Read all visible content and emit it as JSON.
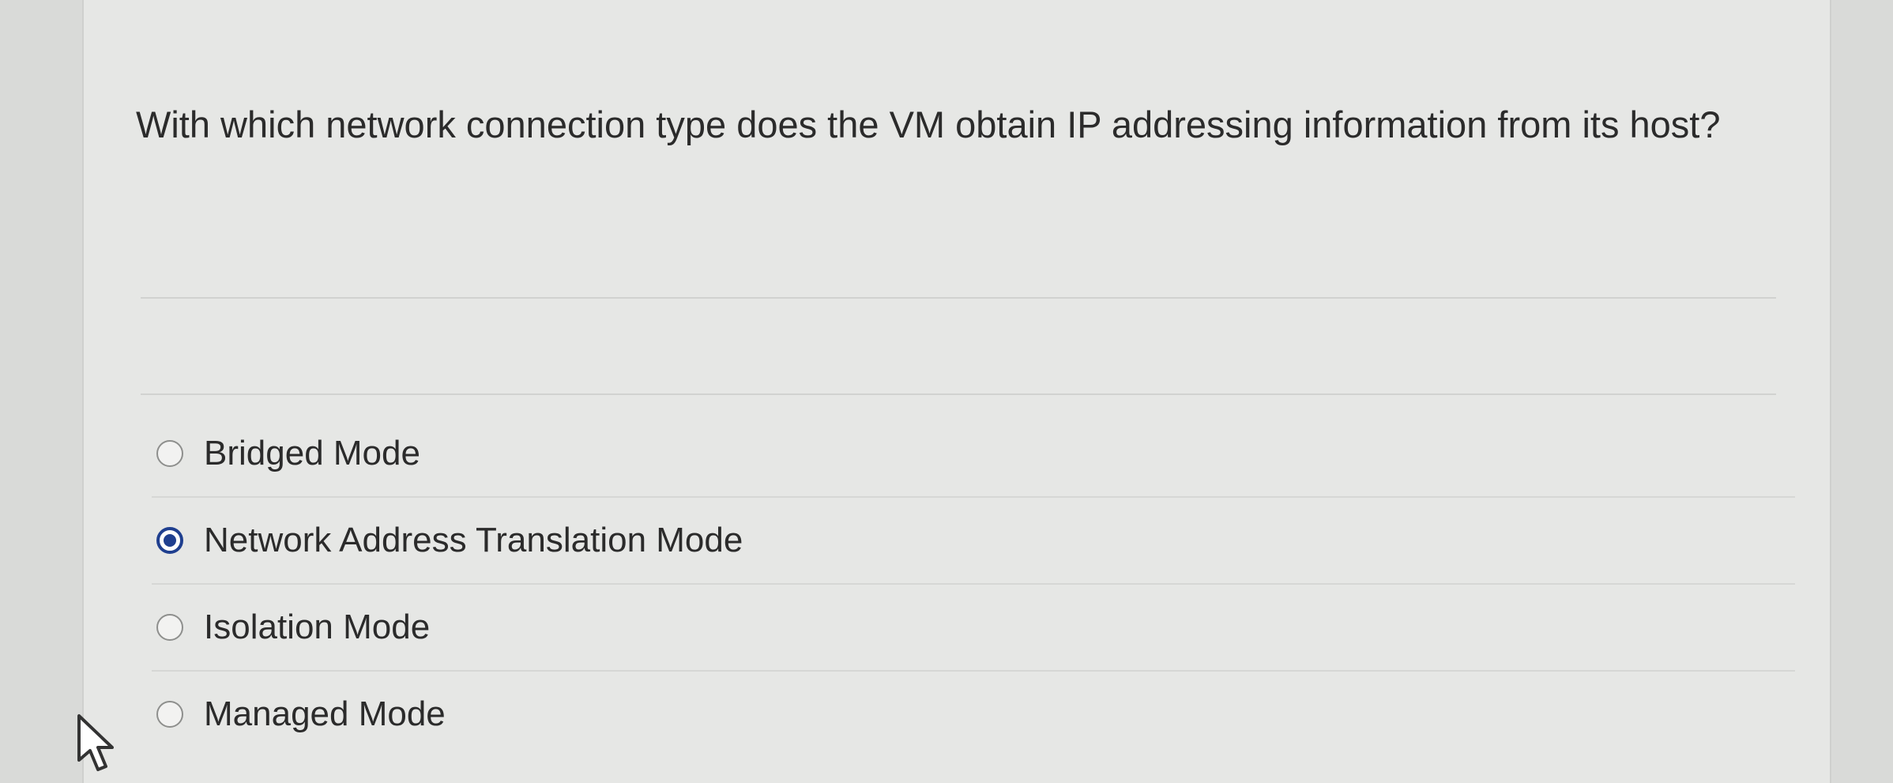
{
  "question": {
    "text": "With which network connection type does the VM obtain IP addressing information from its host?"
  },
  "options": [
    {
      "label": "Bridged Mode",
      "selected": false
    },
    {
      "label": "Network Address Translation Mode",
      "selected": true
    },
    {
      "label": "Isolation Mode",
      "selected": false
    },
    {
      "label": "Managed Mode",
      "selected": false
    }
  ],
  "colors": {
    "radio_selected": "#1f3f8f",
    "text": "#2b2b2b",
    "panel_background": "#e6e7e5"
  },
  "icons": {
    "cursor": "mouse-pointer-icon"
  }
}
